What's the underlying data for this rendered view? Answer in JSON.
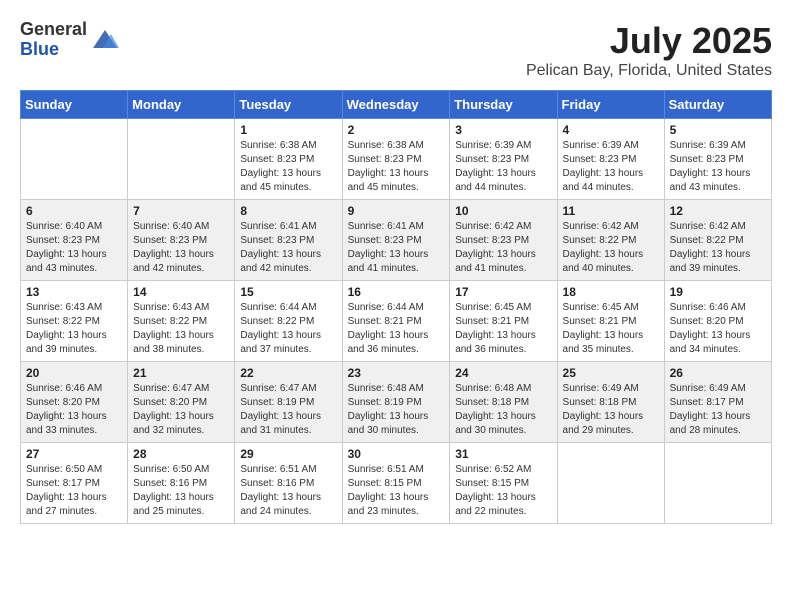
{
  "header": {
    "logo_general": "General",
    "logo_blue": "Blue",
    "title": "July 2025",
    "location": "Pelican Bay, Florida, United States"
  },
  "weekdays": [
    "Sunday",
    "Monday",
    "Tuesday",
    "Wednesday",
    "Thursday",
    "Friday",
    "Saturday"
  ],
  "weeks": [
    [
      {
        "day": "",
        "info": ""
      },
      {
        "day": "",
        "info": ""
      },
      {
        "day": "1",
        "sunrise": "Sunrise: 6:38 AM",
        "sunset": "Sunset: 8:23 PM",
        "daylight": "Daylight: 13 hours and 45 minutes."
      },
      {
        "day": "2",
        "sunrise": "Sunrise: 6:38 AM",
        "sunset": "Sunset: 8:23 PM",
        "daylight": "Daylight: 13 hours and 45 minutes."
      },
      {
        "day": "3",
        "sunrise": "Sunrise: 6:39 AM",
        "sunset": "Sunset: 8:23 PM",
        "daylight": "Daylight: 13 hours and 44 minutes."
      },
      {
        "day": "4",
        "sunrise": "Sunrise: 6:39 AM",
        "sunset": "Sunset: 8:23 PM",
        "daylight": "Daylight: 13 hours and 44 minutes."
      },
      {
        "day": "5",
        "sunrise": "Sunrise: 6:39 AM",
        "sunset": "Sunset: 8:23 PM",
        "daylight": "Daylight: 13 hours and 43 minutes."
      }
    ],
    [
      {
        "day": "6",
        "sunrise": "Sunrise: 6:40 AM",
        "sunset": "Sunset: 8:23 PM",
        "daylight": "Daylight: 13 hours and 43 minutes."
      },
      {
        "day": "7",
        "sunrise": "Sunrise: 6:40 AM",
        "sunset": "Sunset: 8:23 PM",
        "daylight": "Daylight: 13 hours and 42 minutes."
      },
      {
        "day": "8",
        "sunrise": "Sunrise: 6:41 AM",
        "sunset": "Sunset: 8:23 PM",
        "daylight": "Daylight: 13 hours and 42 minutes."
      },
      {
        "day": "9",
        "sunrise": "Sunrise: 6:41 AM",
        "sunset": "Sunset: 8:23 PM",
        "daylight": "Daylight: 13 hours and 41 minutes."
      },
      {
        "day": "10",
        "sunrise": "Sunrise: 6:42 AM",
        "sunset": "Sunset: 8:23 PM",
        "daylight": "Daylight: 13 hours and 41 minutes."
      },
      {
        "day": "11",
        "sunrise": "Sunrise: 6:42 AM",
        "sunset": "Sunset: 8:22 PM",
        "daylight": "Daylight: 13 hours and 40 minutes."
      },
      {
        "day": "12",
        "sunrise": "Sunrise: 6:42 AM",
        "sunset": "Sunset: 8:22 PM",
        "daylight": "Daylight: 13 hours and 39 minutes."
      }
    ],
    [
      {
        "day": "13",
        "sunrise": "Sunrise: 6:43 AM",
        "sunset": "Sunset: 8:22 PM",
        "daylight": "Daylight: 13 hours and 39 minutes."
      },
      {
        "day": "14",
        "sunrise": "Sunrise: 6:43 AM",
        "sunset": "Sunset: 8:22 PM",
        "daylight": "Daylight: 13 hours and 38 minutes."
      },
      {
        "day": "15",
        "sunrise": "Sunrise: 6:44 AM",
        "sunset": "Sunset: 8:22 PM",
        "daylight": "Daylight: 13 hours and 37 minutes."
      },
      {
        "day": "16",
        "sunrise": "Sunrise: 6:44 AM",
        "sunset": "Sunset: 8:21 PM",
        "daylight": "Daylight: 13 hours and 36 minutes."
      },
      {
        "day": "17",
        "sunrise": "Sunrise: 6:45 AM",
        "sunset": "Sunset: 8:21 PM",
        "daylight": "Daylight: 13 hours and 36 minutes."
      },
      {
        "day": "18",
        "sunrise": "Sunrise: 6:45 AM",
        "sunset": "Sunset: 8:21 PM",
        "daylight": "Daylight: 13 hours and 35 minutes."
      },
      {
        "day": "19",
        "sunrise": "Sunrise: 6:46 AM",
        "sunset": "Sunset: 8:20 PM",
        "daylight": "Daylight: 13 hours and 34 minutes."
      }
    ],
    [
      {
        "day": "20",
        "sunrise": "Sunrise: 6:46 AM",
        "sunset": "Sunset: 8:20 PM",
        "daylight": "Daylight: 13 hours and 33 minutes."
      },
      {
        "day": "21",
        "sunrise": "Sunrise: 6:47 AM",
        "sunset": "Sunset: 8:20 PM",
        "daylight": "Daylight: 13 hours and 32 minutes."
      },
      {
        "day": "22",
        "sunrise": "Sunrise: 6:47 AM",
        "sunset": "Sunset: 8:19 PM",
        "daylight": "Daylight: 13 hours and 31 minutes."
      },
      {
        "day": "23",
        "sunrise": "Sunrise: 6:48 AM",
        "sunset": "Sunset: 8:19 PM",
        "daylight": "Daylight: 13 hours and 30 minutes."
      },
      {
        "day": "24",
        "sunrise": "Sunrise: 6:48 AM",
        "sunset": "Sunset: 8:18 PM",
        "daylight": "Daylight: 13 hours and 30 minutes."
      },
      {
        "day": "25",
        "sunrise": "Sunrise: 6:49 AM",
        "sunset": "Sunset: 8:18 PM",
        "daylight": "Daylight: 13 hours and 29 minutes."
      },
      {
        "day": "26",
        "sunrise": "Sunrise: 6:49 AM",
        "sunset": "Sunset: 8:17 PM",
        "daylight": "Daylight: 13 hours and 28 minutes."
      }
    ],
    [
      {
        "day": "27",
        "sunrise": "Sunrise: 6:50 AM",
        "sunset": "Sunset: 8:17 PM",
        "daylight": "Daylight: 13 hours and 27 minutes."
      },
      {
        "day": "28",
        "sunrise": "Sunrise: 6:50 AM",
        "sunset": "Sunset: 8:16 PM",
        "daylight": "Daylight: 13 hours and 25 minutes."
      },
      {
        "day": "29",
        "sunrise": "Sunrise: 6:51 AM",
        "sunset": "Sunset: 8:16 PM",
        "daylight": "Daylight: 13 hours and 24 minutes."
      },
      {
        "day": "30",
        "sunrise": "Sunrise: 6:51 AM",
        "sunset": "Sunset: 8:15 PM",
        "daylight": "Daylight: 13 hours and 23 minutes."
      },
      {
        "day": "31",
        "sunrise": "Sunrise: 6:52 AM",
        "sunset": "Sunset: 8:15 PM",
        "daylight": "Daylight: 13 hours and 22 minutes."
      },
      {
        "day": "",
        "info": ""
      },
      {
        "day": "",
        "info": ""
      }
    ]
  ]
}
